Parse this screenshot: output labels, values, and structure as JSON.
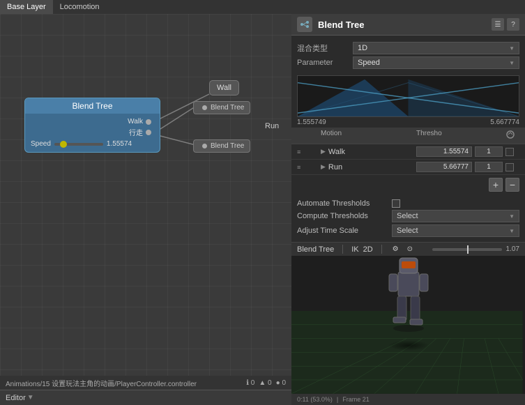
{
  "tabs": {
    "base_layer": "Base Layer",
    "locomotion": "Locomotion"
  },
  "left_panel": {
    "nodes": {
      "blend_tree_main": {
        "title": "Blend Tree",
        "walk_label": "Walk",
        "walk_cn": "行走",
        "speed_label": "Speed",
        "speed_value": "1.55574"
      },
      "wall": {
        "label": "Wall"
      },
      "bt_walk": {
        "label": "Blend Tree"
      },
      "bt_run": {
        "label": "Blend Tree"
      }
    },
    "status": "Animations/15 设置玩法主角的动画/PlayerController.controller",
    "editor_label": "Editor",
    "icons": {
      "info": "ℹ",
      "warn": "▲",
      "error": "●"
    },
    "counts": {
      "info": "0",
      "warn": "0",
      "error": "0"
    }
  },
  "right_panel": {
    "title": "Blend Tree",
    "subtitle": "混合类型",
    "type_value": "1D",
    "parameter_label": "Parameter",
    "parameter_value": "Speed",
    "graph": {
      "min": "1.555749",
      "max": "5.667774"
    },
    "motion_table": {
      "headers": {
        "col1": "Motion",
        "col2": "Thresho",
        "col3": "",
        "col4": ""
      },
      "rows": [
        {
          "name": "Walk",
          "threshold": "1.55574",
          "multiplier": "1",
          "checked": false
        },
        {
          "name": "Run",
          "threshold": "5.66777",
          "multiplier": "1",
          "checked": false
        }
      ]
    },
    "automate": {
      "label": "Automate Thresholds",
      "compute_label": "Compute Thresholds",
      "compute_value": "Select",
      "adjust_label": "Adjust Time Scale",
      "adjust_value": "Select"
    },
    "playback": {
      "label": "Blend Tree",
      "ik_label": "IK",
      "twod_label": "2D",
      "time_value": "1.07"
    },
    "info_bar": {
      "time": "0:11 (53.0%)",
      "frame": "Frame 21"
    }
  }
}
